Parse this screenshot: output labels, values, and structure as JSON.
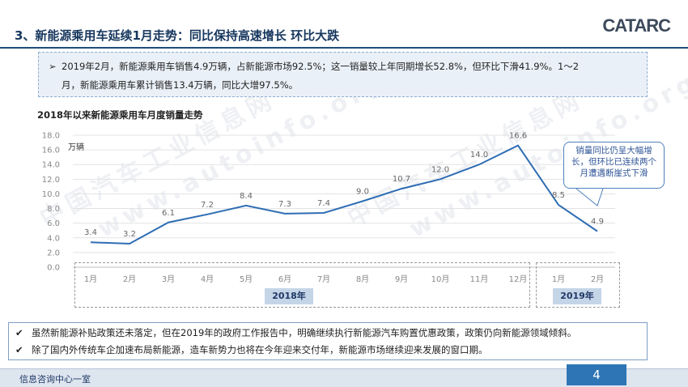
{
  "header": {
    "title": "3、新能源乘用车延续1月走势：同比保持高速增长 环比大跌",
    "logo": "CATARC"
  },
  "summary": {
    "bullet": "➢",
    "line1": "2019年2月，新能源乘用车销售4.9万辆，占新能源市场92.5%；这一销量较上年同期增长52.8%，但环比下滑41.9%。1～2",
    "line2": "月，新能源乘用车累计销售13.4万辆，同比大增97.5%。"
  },
  "chart_data": {
    "type": "line",
    "title": "2018年以来新能源乘用车月度销量走势",
    "unit_label": "万辆",
    "categories": [
      "1月",
      "2月",
      "3月",
      "4月",
      "5月",
      "6月",
      "7月",
      "8月",
      "9月",
      "10月",
      "11月",
      "12月",
      "1月",
      "2月"
    ],
    "values": [
      3.4,
      3.2,
      6.1,
      7.2,
      8.4,
      7.3,
      7.4,
      9.0,
      10.7,
      12.0,
      14.0,
      16.6,
      8.5,
      4.9
    ],
    "data_labels": [
      "3.4",
      "3.2",
      "6.1",
      "7.2",
      "8.4",
      "7.3",
      "7.4",
      "9.0",
      "10.7",
      "12.0",
      "14.0",
      "16.6",
      "8.5",
      "4.9"
    ],
    "ylim": [
      0,
      18
    ],
    "yticks": [
      "0.0",
      "2.0",
      "4.0",
      "6.0",
      "8.0",
      "10.0",
      "12.0",
      "14.0",
      "16.0",
      "18.0"
    ],
    "groups": [
      {
        "label": "2018年",
        "start": 0,
        "end": 11
      },
      {
        "label": "2019年",
        "start": 12,
        "end": 13
      }
    ],
    "line_color": "#2e6db4",
    "annotation": "销量同比仍呈大幅增长，但环比已连续两个月遭遇断崖式下滑"
  },
  "notes": {
    "check": "✔",
    "items": [
      "虽然新能源补贴政策还未落定，但在2019年的政府工作报告中，明确继续执行新能源汽车购置优惠政策，政策仍向新能源领域倾斜。",
      "除了国内外传统车企加速布局新能源，造车新势力也将在今年迎来交付年，新能源市场继续迎来发展的窗口期。"
    ]
  },
  "footer": {
    "org": "信息咨询中心一室",
    "page": "4"
  },
  "watermark": {
    "cn": "中国汽车工业信息网",
    "url": "www.autoinfo.org.cn"
  }
}
